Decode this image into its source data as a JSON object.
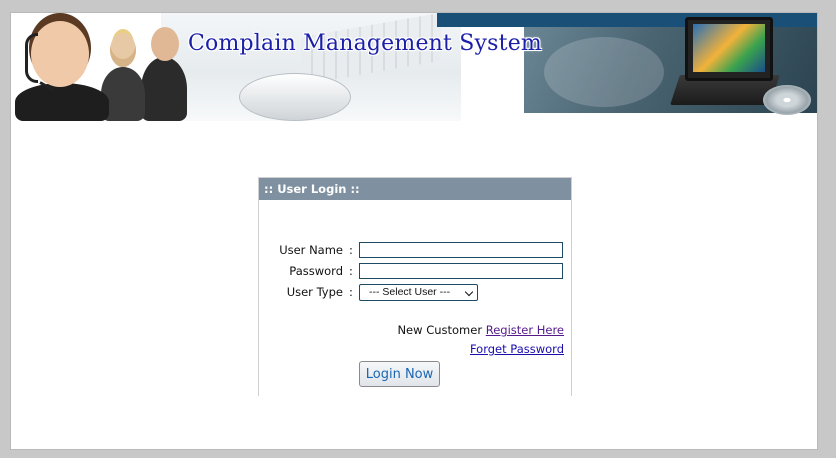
{
  "banner": {
    "title": "Complain Management System"
  },
  "login": {
    "header": ":: User Login ::",
    "fields": {
      "username_label": "User Name",
      "password_label": "Password",
      "usertype_label": "User Type",
      "colon": ":",
      "username_value": "",
      "password_value": ""
    },
    "user_type": {
      "selected": "--- Select User ---"
    },
    "new_customer_text": "New Customer",
    "register_link": "Register Here",
    "forget_link": "Forget Password",
    "submit_label": "Login Now"
  },
  "colors": {
    "page_background": "#c8c8c8",
    "header_bar": "#7f90a0",
    "title_text": "#1b1fa8",
    "input_border": "#1d4b66",
    "visited_link": "#551a8b",
    "link": "#1a0dab",
    "button_text": "#1a66b3"
  }
}
